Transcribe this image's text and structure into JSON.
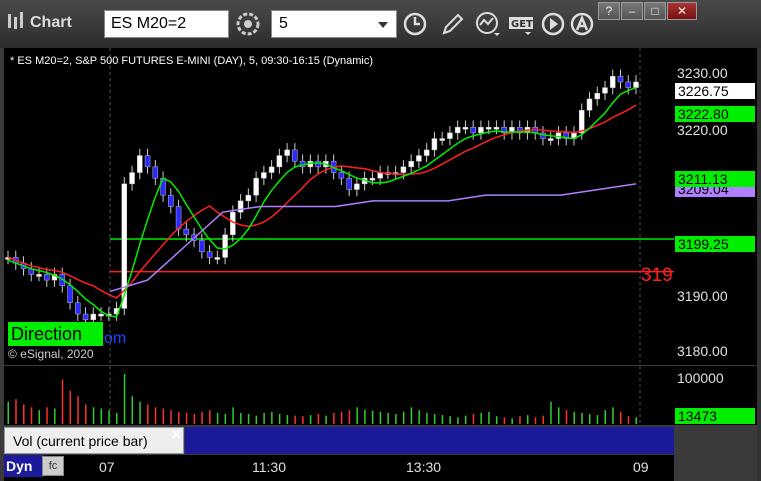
{
  "toolbar": {
    "app_title": "Chart",
    "symbol": "ES M20=2",
    "interval": "5",
    "icons": [
      "gear-icon",
      "clock-icon",
      "pencil-icon",
      "study-icon",
      "get-icon",
      "play-icon",
      "caret-icon"
    ],
    "window_buttons": [
      "?",
      "–",
      "□",
      "✕"
    ]
  },
  "chart": {
    "header": "* ES M20=2, S&P 500 FUTURES E-MINI (DAY), 5, 09:30-16:15 (Dynamic)",
    "price_ticks": [
      "3230.00",
      "3220.00",
      "3190.00",
      "3180.00"
    ],
    "price_tags": [
      {
        "label": "3226.75",
        "bg": "#ffffff",
        "fg": "#000000"
      },
      {
        "label": "3222.80",
        "bg": "#00ee00",
        "fg": "#000000"
      },
      {
        "label": "3211.13",
        "bg": "#00ee00",
        "fg": "#000000"
      },
      {
        "label": "3209.04",
        "bg": "#b080ff",
        "fg": "#000000"
      },
      {
        "label": "3199.25",
        "bg": "#00ee00",
        "fg": "#000000"
      }
    ],
    "red_label_partial": "319",
    "direction_label": "Direction",
    "link_fragment": "om",
    "copyright": "© eSignal, 2020"
  },
  "volume": {
    "axis_label": "100000",
    "current_tag": "13473",
    "tab_label": "Vol (current price bar)",
    "close_symbol": "✕"
  },
  "time_axis": {
    "labels": [
      "07",
      "11:30",
      "13:30",
      "09"
    ],
    "dyn_label": "Dyn",
    "dyn_icon": "fc"
  },
  "chart_data": {
    "type": "candlestick",
    "symbol": "ES M20=2",
    "interval": "5",
    "y_range": [
      3177,
      3233
    ],
    "horizontal_lines": [
      {
        "value": 3199.25,
        "color": "#00ee00"
      },
      {
        "value": 3193.5,
        "color": "#ff2020"
      }
    ],
    "last_price": 3226.75,
    "closes": [
      3196,
      3195,
      3194,
      3193,
      3193,
      3192,
      3193,
      3191,
      3188,
      3186,
      3185,
      3186,
      3186,
      3186,
      3187,
      3209,
      3211,
      3214,
      3212,
      3210,
      3207,
      3205,
      3201,
      3200,
      3199,
      3197,
      3196,
      3196,
      3200,
      3204,
      3206,
      3207,
      3210,
      3211,
      3212,
      3214,
      3215,
      3213,
      3212,
      3213,
      3212,
      3213,
      3211,
      3210,
      3208,
      3209,
      3210,
      3210,
      3211,
      3211,
      3211,
      3212,
      3213,
      3214,
      3215,
      3217,
      3217,
      3218,
      3219,
      3219,
      3218,
      3219,
      3219,
      3219,
      3218,
      3219,
      3218,
      3219,
      3218,
      3217,
      3217,
      3218,
      3217,
      3218,
      3222,
      3224,
      3225,
      3226,
      3228,
      3227,
      3226,
      3227
    ],
    "vwap_purple": [
      3190,
      3192,
      3198,
      3204,
      3205,
      3205,
      3205,
      3206,
      3206,
      3206,
      3207,
      3207,
      3207,
      3208,
      3209
    ],
    "volume": [
      40,
      45,
      35,
      30,
      25,
      30,
      28,
      80,
      60,
      50,
      35,
      30,
      28,
      25,
      20,
      90,
      50,
      40,
      35,
      30,
      28,
      25,
      22,
      20,
      18,
      22,
      25,
      20,
      18,
      30,
      20,
      18,
      15,
      20,
      22,
      18,
      16,
      15,
      14,
      16,
      18,
      15,
      20,
      22,
      25,
      30,
      26,
      24,
      22,
      20,
      18,
      22,
      30,
      25,
      20,
      18,
      16,
      14,
      12,
      15,
      18,
      20,
      22,
      14,
      12,
      10,
      14,
      16,
      12,
      15,
      40,
      30,
      25,
      22,
      20,
      18,
      16,
      25,
      30,
      22,
      14,
      12
    ]
  }
}
